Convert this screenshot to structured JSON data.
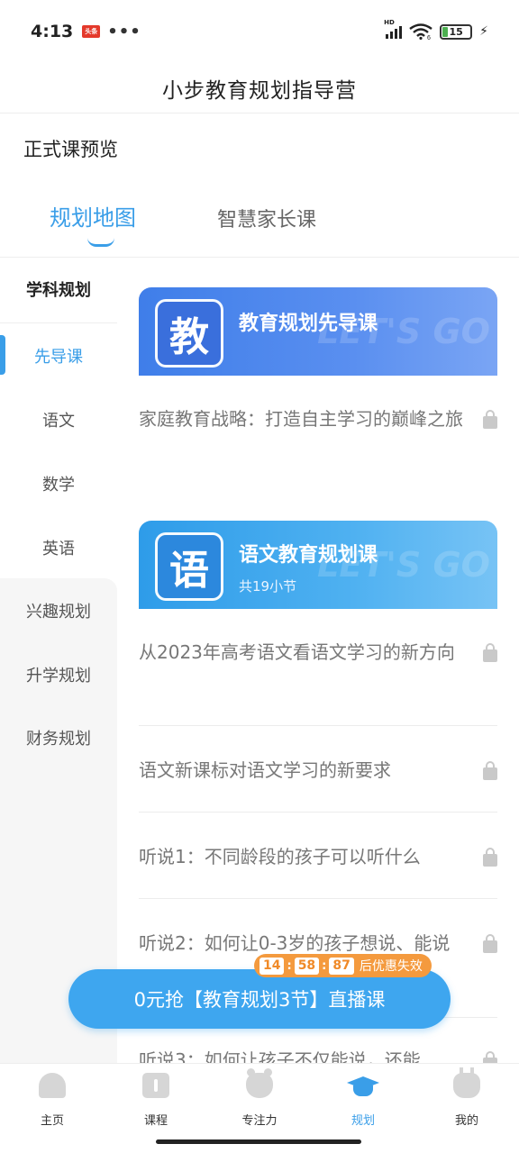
{
  "status_bar": {
    "time": "4:13",
    "news_badge": "头条",
    "more": "•••",
    "network": "HD",
    "wifi_sub": "6",
    "battery": "15",
    "charging": "⚡"
  },
  "header": {
    "title": "小步教育规划指导营"
  },
  "preview_title": "正式课预览",
  "tabs": [
    {
      "label": "规划地图",
      "active": true
    },
    {
      "label": "智慧家长课",
      "active": false
    }
  ],
  "sidebar": {
    "heading": "学科规划",
    "subjects": [
      "先导课",
      "语文",
      "数学",
      "英语"
    ],
    "groups": [
      "兴趣规划",
      "升学规划",
      "财务规划"
    ]
  },
  "sections": [
    {
      "icon_char": "教",
      "title": "教育规划先导课",
      "subtitle": "",
      "decor": "LET'S GO",
      "lessons": [
        "家庭教育战略：打造自主学习的巅峰之旅"
      ]
    },
    {
      "icon_char": "语",
      "title": "语文教育规划课",
      "subtitle": "共19小节",
      "decor": "LET'S GO",
      "lessons": [
        "从2023年高考语文看语文学习的新方向",
        "语文新课标对语文学习的新要求",
        "听说1：不同龄段的孩子可以听什么",
        "听说2：如何让0-3岁的孩子想说、能说",
        "听说3：如何让孩子不仅能说，还能"
      ]
    }
  ],
  "promo": {
    "label": "0元抢【教育规划3节】直播课",
    "countdown": {
      "hours": "14",
      "minutes": "58",
      "seconds": "87",
      "suffix": "后优惠失效"
    }
  },
  "bottom_nav": [
    {
      "label": "主页",
      "active": false
    },
    {
      "label": "课程",
      "active": false
    },
    {
      "label": "专注力",
      "active": false
    },
    {
      "label": "规划",
      "active": true
    },
    {
      "label": "我的",
      "active": false
    }
  ],
  "colors": {
    "accent": "#3a9ee8",
    "banner1": "#4a84ec",
    "banner2": "#3aa5ee",
    "countdown": "#f49a3e"
  }
}
